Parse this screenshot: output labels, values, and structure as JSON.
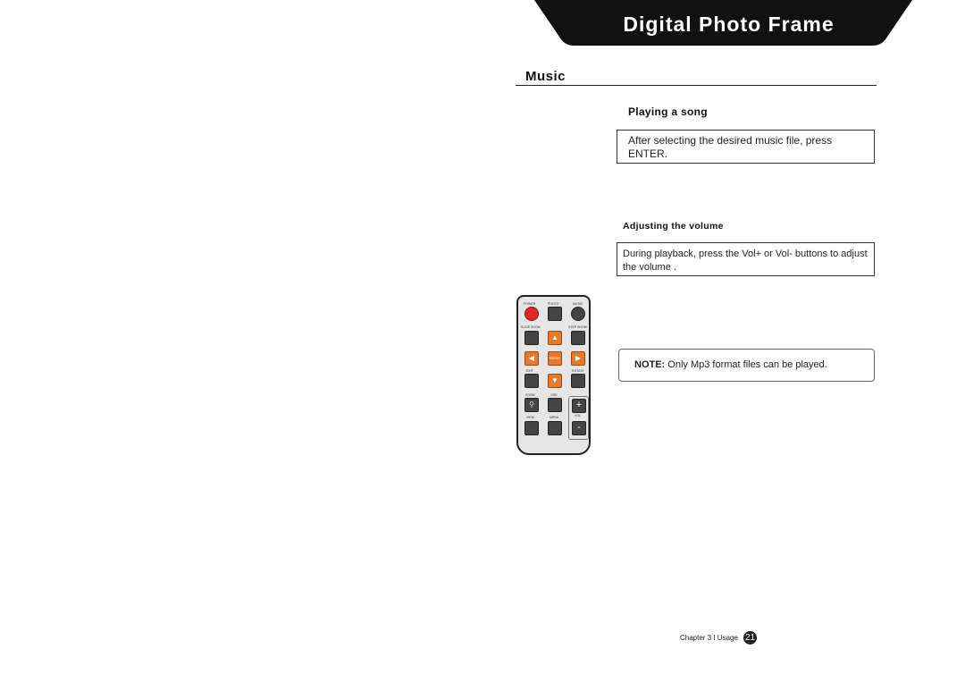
{
  "header": {
    "title": "Digital Photo Frame"
  },
  "section": {
    "title": "Music"
  },
  "playing": {
    "heading": "Playing a song",
    "text": "After selecting the desired music file, press ENTER."
  },
  "volume": {
    "heading": "Adjusting the volume",
    "text": "During playback, press the Vol+ or Vol-  buttons to adjust the volume ."
  },
  "note": {
    "label": "NOTE:",
    "text": "Only Mp3 format files can be played."
  },
  "remote": {
    "labels": {
      "power": "POWER",
      "photo": "PHOTO",
      "music": "MUSIC",
      "slideshow": "SLIDE SHOW",
      "stepshow": "STEP SHOW",
      "enter": "ENTER",
      "exit": "EXIT",
      "rotate": "ROTATE",
      "zoom": "ZOOM",
      "osd": "OSD",
      "view": "VIEW",
      "menu": "MENU",
      "vol": "VOL",
      "plus": "+",
      "minus": "-"
    }
  },
  "footer": {
    "chapter": "Chapter 3 I Usage",
    "page": "21"
  },
  "colors": {
    "accent": "#e8782a",
    "power": "#e0282a",
    "banner": "#111111"
  }
}
